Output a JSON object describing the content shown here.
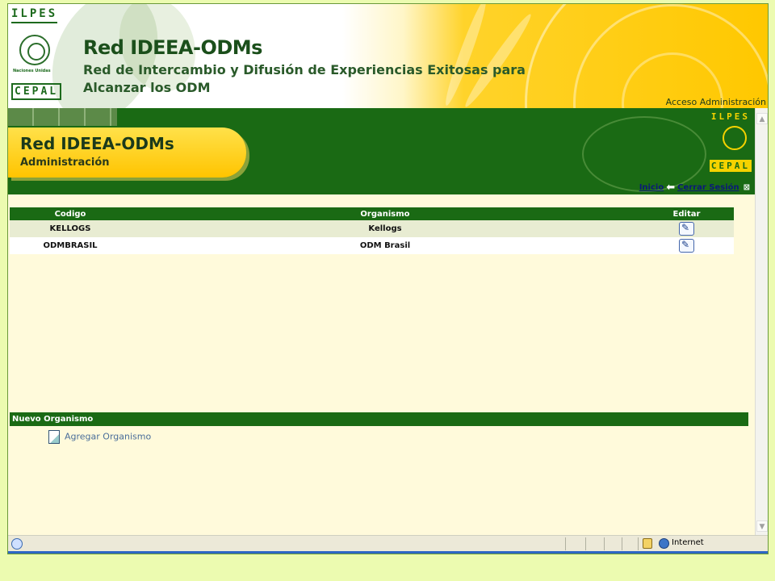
{
  "banner": {
    "logo_top": "ILPES",
    "logo_caption": "Naciones Unidas",
    "logo_bottom": "CEPAL",
    "title": "Red IDEEA-ODMs",
    "subtitle_line1": "Red de Intercambio y Difusión de Experiencias Exitosas para",
    "subtitle_line2": "Alcanzar los ODM"
  },
  "admin_band": {
    "access_label": "Acceso Administración",
    "title": "Red IDEEA-ODMs",
    "subtitle": "Administración",
    "logo_top": "ILPES",
    "logo_bottom": "CEPAL",
    "nav": {
      "home": "Inicio",
      "logout": "Cerrar Sesión"
    }
  },
  "table": {
    "headers": [
      "Codigo",
      "Organismo",
      "Editar"
    ],
    "rows": [
      {
        "code": "KELLOGS",
        "org": "Kellogs"
      },
      {
        "code": "ODMBRASIL",
        "org": "ODM Brasil"
      }
    ]
  },
  "new_section": {
    "header": "Nuevo Organismo",
    "add_label": "Agregar Organismo"
  },
  "statusbar": {
    "zone": "Internet"
  },
  "colors": {
    "green": "#1a6a14",
    "yellow": "#ffc400",
    "cream": "#fffadb",
    "page_bg": "#ecfbb0"
  }
}
